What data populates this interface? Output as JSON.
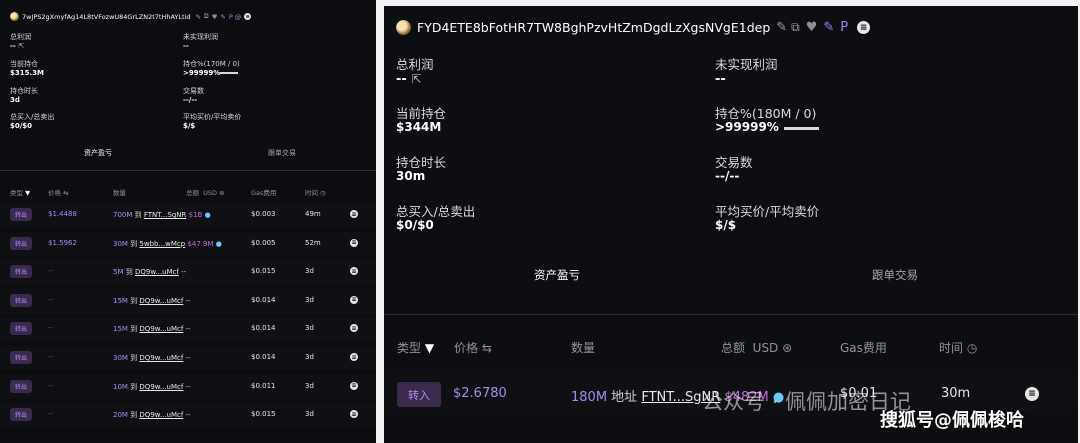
{
  "left": {
    "address": "7wJPS2gXmyfAg14L8tVFozwU84GrLZN2t7tHhAYLtid",
    "stats": [
      {
        "label": "总利润",
        "value": "--"
      },
      {
        "label": "未实现利润",
        "value": "--"
      },
      {
        "label": "当前持仓",
        "value": "$315.3M"
      },
      {
        "label": "持仓%(170M / 0)",
        "value": ">99999%"
      },
      {
        "label": "持仓时长",
        "value": "3d"
      },
      {
        "label": "交易数",
        "value": "--/--"
      },
      {
        "label": "总买入/总卖出",
        "value": "$0/$0"
      },
      {
        "label": "平均买价/平均卖价",
        "value": "$/$"
      }
    ],
    "tabs": [
      "资产盈亏",
      "跟单交易"
    ],
    "columns": [
      "类型",
      "价格",
      "数量",
      "总额",
      "USD",
      "Gas费用",
      "时间"
    ],
    "rows": [
      {
        "type": "转出",
        "price": "$1.4488",
        "qty": "700M",
        "to": "到",
        "addr": "FTNT...SgNR",
        "usd": "$1B",
        "gas": "$0.003",
        "time": "49m"
      },
      {
        "type": "转出",
        "price": "$1.5962",
        "qty": "30M",
        "to": "到",
        "addr": "5wbb...wMcp",
        "usd": "$47.9M",
        "gas": "$0.005",
        "time": "52m"
      },
      {
        "type": "转出",
        "price": "--",
        "qty": "5M",
        "to": "到",
        "addr": "DQ9w...uMcf",
        "usd": "--",
        "gas": "$0.015",
        "time": "3d"
      },
      {
        "type": "转出",
        "price": "--",
        "qty": "15M",
        "to": "到",
        "addr": "DQ9w...uMcf",
        "usd": "--",
        "gas": "$0.014",
        "time": "3d"
      },
      {
        "type": "转出",
        "price": "--",
        "qty": "15M",
        "to": "到",
        "addr": "DQ9w...uMcf",
        "usd": "--",
        "gas": "$0.014",
        "time": "3d"
      },
      {
        "type": "转出",
        "price": "--",
        "qty": "30M",
        "to": "到",
        "addr": "DQ9w...uMcf",
        "usd": "--",
        "gas": "$0.014",
        "time": "3d"
      },
      {
        "type": "转出",
        "price": "--",
        "qty": "10M",
        "to": "到",
        "addr": "DQ9w...uMcf",
        "usd": "--",
        "gas": "$0.011",
        "time": "3d"
      },
      {
        "type": "转出",
        "price": "--",
        "qty": "20M",
        "to": "到",
        "addr": "DQ9w...uMcf",
        "usd": "--",
        "gas": "$0.015",
        "time": "3d"
      }
    ]
  },
  "right": {
    "address": "FYD4ETE8bFotHR7TW8BghPzvHtZmDgdLzXgsNVgE1dep",
    "stats": [
      {
        "label": "总利润",
        "value": "--"
      },
      {
        "label": "未实现利润",
        "value": "--"
      },
      {
        "label": "当前持仓",
        "value": "$344M"
      },
      {
        "label": "持仓%(180M / 0)",
        "value": ">99999%"
      },
      {
        "label": "持仓时长",
        "value": "30m"
      },
      {
        "label": "交易数",
        "value": "--/--"
      },
      {
        "label": "总买入/总卖出",
        "value": "$0/$0"
      },
      {
        "label": "平均买价/平均卖价",
        "value": "$/$"
      }
    ],
    "tabs": [
      "资产盈亏",
      "跟单交易"
    ],
    "columns": [
      "类型",
      "价格",
      "数量",
      "总额",
      "USD",
      "Gas费用",
      "时间"
    ],
    "rows": [
      {
        "type": "转入",
        "price": "$2.6780",
        "qty": "180M",
        "to": "地址",
        "addr": "FTNT...SgNR",
        "usd": "$482M",
        "gas": "$0.01",
        "time": "30m"
      }
    ]
  },
  "watermark": {
    "main": "搜狐号@佩佩梭哈",
    "faint": "公众号 · 佩佩加密日记"
  },
  "icons": [
    "link-icon",
    "copy-icon",
    "heart-icon",
    "pen-icon",
    "p-icon",
    "menu-icon",
    "filter-icon",
    "clock-icon",
    "coin-icon"
  ]
}
